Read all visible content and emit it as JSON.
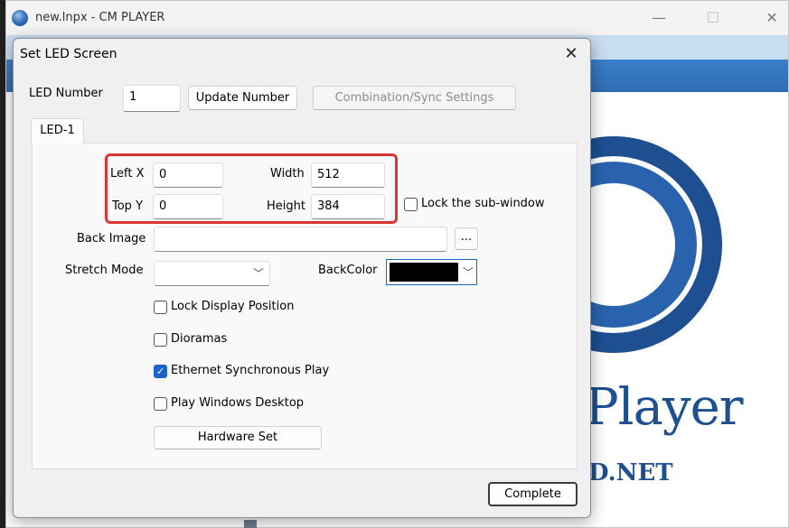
{
  "app": {
    "title": "new.lnpx - CM PLAYER",
    "minimize": "—",
    "maximize": "☐",
    "close": "✕",
    "logo_text": "Player",
    "logo_sub": "D.NET"
  },
  "dialog": {
    "title": "Set LED Screen",
    "close": "✕",
    "led_number_label": "LED Number",
    "led_number_value": "1",
    "update_number_button": "Update Number",
    "combination_button": "Combination/Sync Settings",
    "tab": "LED-1",
    "left_x_label": "Left X",
    "left_x_value": "0",
    "top_y_label": "Top Y",
    "top_y_value": "0",
    "width_label": "Width",
    "width_value": "512",
    "height_label": "Height",
    "height_value": "384",
    "lock_subwindow_label": "Lock the sub-window",
    "lock_subwindow_checked": false,
    "back_image_label": "Back Image",
    "back_image_value": "",
    "browse_button": "...",
    "stretch_mode_label": "Stretch Mode",
    "stretch_mode_value": "",
    "backcolor_label": "BackColor",
    "backcolor_value": "#000000",
    "lock_display_position_label": "Lock Display Position",
    "lock_display_position_checked": false,
    "dioramas_label": "Dioramas",
    "dioramas_checked": false,
    "ethernet_sync_label": "Ethernet Synchronous Play",
    "ethernet_sync_checked": true,
    "play_windows_desktop_label": "Play Windows Desktop",
    "play_windows_desktop_checked": false,
    "hardware_set_button": "Hardware Set",
    "complete_button": "Complete"
  },
  "colors": {
    "accent": "#1a64c8",
    "highlight": "#d93535",
    "toolbar": "#3a7ec9",
    "logo": "#1d4f91"
  }
}
